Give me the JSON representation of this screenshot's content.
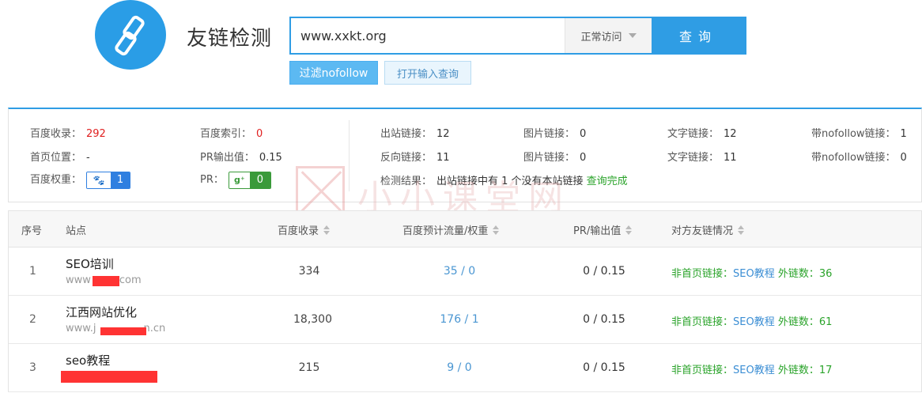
{
  "header": {
    "title": "友链检测",
    "search_value": "www.xxkt.org",
    "mode": "正常访问",
    "query_label": "查询",
    "filter_button": "过滤nofollow",
    "open_input_button": "打开输入查询",
    "logo_icon": "chain-link-icon",
    "accent_color": "#2f9de4"
  },
  "stats": {
    "baidu_indexed_label": "百度收录：",
    "baidu_indexed": "292",
    "baidu_index_label": "百度索引：",
    "baidu_index": "0",
    "home_position_label": "首页位置：",
    "home_position": "-",
    "pr_output_label": "PR输出值：",
    "pr_output": "0.15",
    "baidu_weight_label": "百度权重：",
    "baidu_weight": "1",
    "pr_label": "PR：",
    "pr": "0",
    "outbound_links_label": "出站链接：",
    "outbound_links": "12",
    "image_links_label": "图片链接：",
    "image_links_out": "0",
    "text_links_label": "文字链接：",
    "text_links_out": "12",
    "nofollow_links_label": "带nofollow链接：",
    "nofollow_links_out": "1",
    "backlinks_label": "反向链接：",
    "backlinks": "11",
    "image_links_back": "0",
    "text_links_back": "11",
    "nofollow_links_back": "0",
    "check_result_label": "检测结果：",
    "check_result_msg": "出站链接中有 1 个没有本站链接",
    "check_done": "查询完成"
  },
  "watermark": {
    "text": "小小课堂网",
    "url": "www.xxkt.org"
  },
  "table": {
    "columns": [
      "序号",
      "站点",
      "百度收录",
      "百度预计流量/权重",
      "PR/输出值",
      "对方友链情况"
    ],
    "rows": [
      {
        "num": "1",
        "name": "SEO培训",
        "url_prefix": "www",
        "url_suffix": "com",
        "indexed": "334",
        "flow": "35 / 0",
        "pr": "0 / 0.15",
        "status_prefix": "非首页链接：",
        "status_link": "SEO教程",
        "status_suffix": " 外链数：36"
      },
      {
        "num": "2",
        "name": "江西网站优化",
        "url_prefix": "www.j",
        "url_suffix": "n.cn",
        "indexed": "18,300",
        "flow": "176 / 1",
        "pr": "0 / 0.15",
        "status_prefix": "非首页链接：",
        "status_link": "SEO教程",
        "status_suffix": " 外链数：61"
      },
      {
        "num": "3",
        "name": "seo教程",
        "url_prefix": "",
        "url_suffix": "",
        "indexed": "215",
        "flow": "9 / 0",
        "pr": "0 / 0.15",
        "status_prefix": "非首页链接：",
        "status_link": "SEO教程",
        "status_suffix": " 外链数：17"
      }
    ]
  }
}
